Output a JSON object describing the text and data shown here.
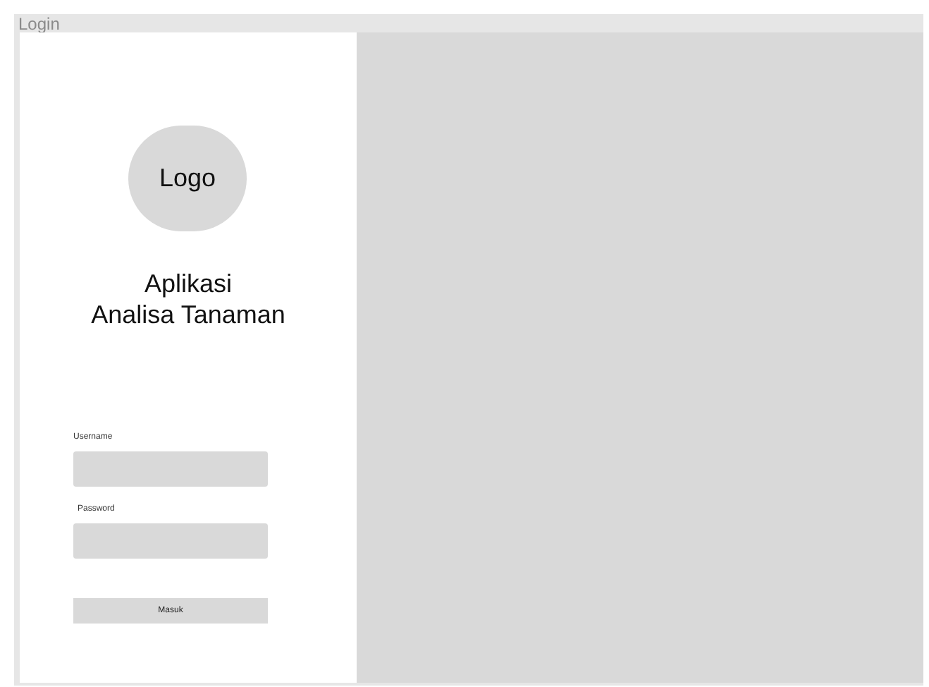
{
  "window": {
    "title": "Login"
  },
  "logo": {
    "label": "Logo"
  },
  "app_title": [
    "Aplikasi",
    "Analisa Tanaman"
  ],
  "fields": [
    {
      "label": "Username"
    },
    {
      "label": "Password"
    }
  ],
  "submit_button": {
    "label": "Masuk"
  }
}
